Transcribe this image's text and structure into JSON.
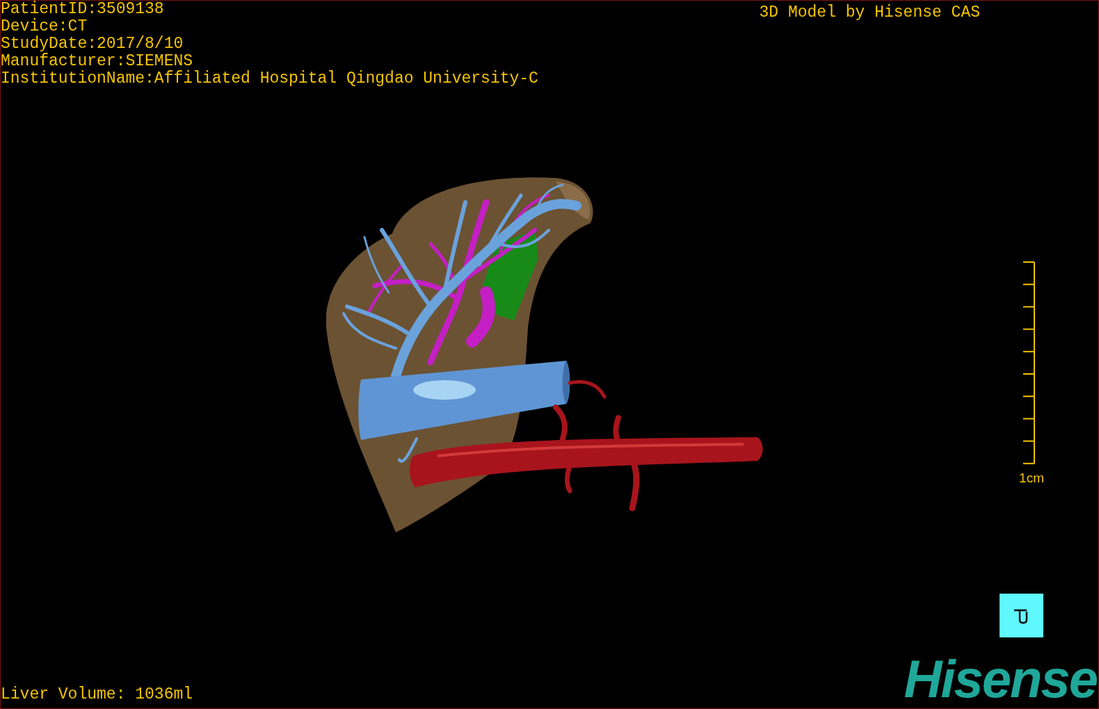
{
  "info_lines": [
    "PatientID:3509138",
    "Device:CT",
    "StudyDate:2017/8/10",
    "Manufacturer:SIEMENS",
    "InstitutionName:Affiliated Hospital Qingdao University-C"
  ],
  "title": "3D Model by Hisense CAS",
  "scale_bar": {
    "label": "1cm"
  },
  "volume": "Liver Volume: 1036ml",
  "logo": "Hisense"
}
